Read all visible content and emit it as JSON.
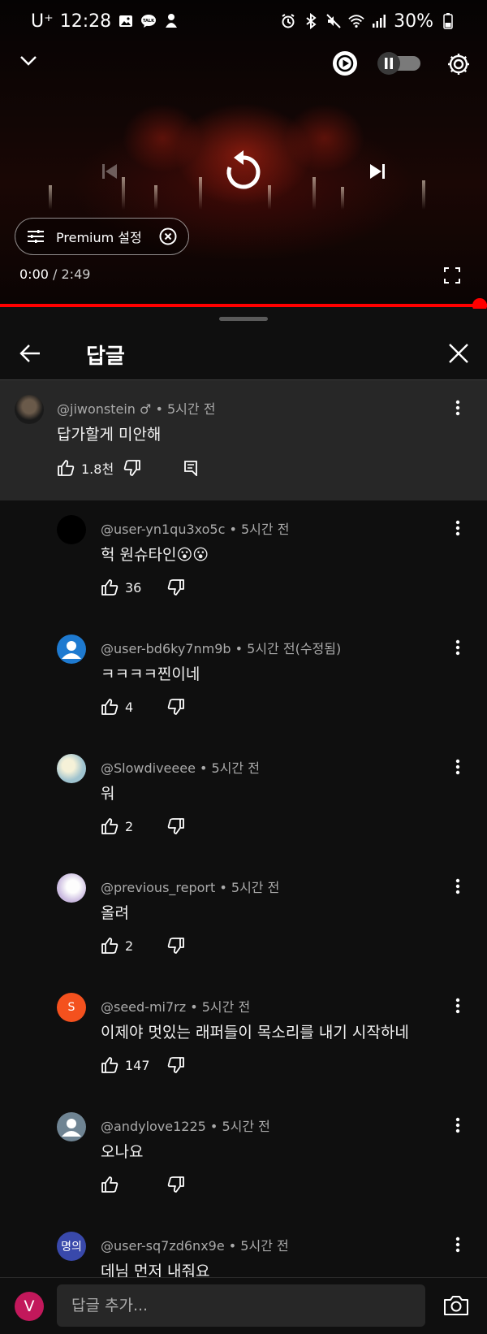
{
  "status_bar": {
    "carrier": "U⁺",
    "time": "12:28",
    "battery": "30%",
    "left_icons": [
      "gallery-icon",
      "talk-icon",
      "notification-icon"
    ],
    "right_icons": [
      "alarm-icon",
      "bluetooth-icon",
      "mute-icon",
      "wifi-icon",
      "signal-icon",
      "battery-icon"
    ]
  },
  "player": {
    "premium_chip_label": "Premium 설정",
    "current_time": "0:00",
    "separator": " / ",
    "duration": "2:49",
    "progress": 1.0,
    "accent_color": "#ff0000"
  },
  "panel": {
    "title": "답글"
  },
  "parent_comment": {
    "author": "@jiwonstein ♂",
    "time": " • 5시간 전",
    "text": "답가할게 미안해",
    "likes": "1.8천"
  },
  "replies": [
    {
      "author": "@user-yn1qu3xo5c",
      "time": " • 5시간 전",
      "text": "헉 원슈타인😮😮",
      "likes": "36",
      "avatar_letter": "",
      "avatar_color": "#000000"
    },
    {
      "author": "@user-bd6ky7nm9b",
      "time": " • 5시간 전(수정됨)",
      "text": "ㅋㅋㅋㅋ찐이네",
      "likes": "4",
      "avatar_letter": "",
      "avatar_color": "#1e7ad0"
    },
    {
      "author": "@Slowdiveeee",
      "time": " • 5시간 전",
      "text": "워",
      "likes": "2",
      "avatar_letter": "",
      "avatar_color": "#9fc3cf"
    },
    {
      "author": "@previous_report",
      "time": " • 5시간 전",
      "text": "올려",
      "likes": "2",
      "avatar_letter": "",
      "avatar_color": "#cbbbe0"
    },
    {
      "author": "@seed-mi7rz",
      "time": " • 5시간 전",
      "text": "이제야 멋있는 래퍼들이 목소리를 내기 시작하네",
      "likes": "147",
      "avatar_letter": "S",
      "avatar_color": "#f4511e"
    },
    {
      "author": "@andylove1225",
      "time": " • 5시간 전",
      "text": "오나요",
      "likes": "",
      "avatar_letter": "",
      "avatar_color": "#6f8493"
    },
    {
      "author": "@user-sq7zd6nx9e",
      "time": " • 5시간 전",
      "text": "데님 먼저 내줘요",
      "likes": "",
      "avatar_letter": "명의",
      "avatar_color": "#3949ab"
    }
  ],
  "reply_box": {
    "placeholder": "답글 추가...",
    "user_initial": "V"
  }
}
